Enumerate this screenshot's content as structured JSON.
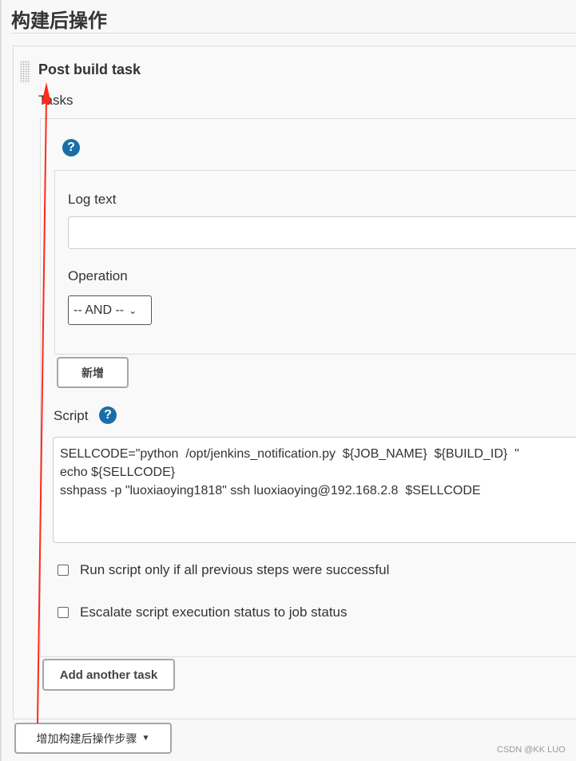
{
  "section_title": "构建后操作",
  "step": {
    "title": "Post build task",
    "tasks_label": "Tasks",
    "log_text_label": "Log text",
    "log_text_value": "",
    "operation_label": "Operation",
    "operation_value": "-- AND --",
    "add_button": "新增",
    "script_label": "Script",
    "script_lines": [
      "SELLCODE=\"python  /opt/jenkins_notification.py  ${JOB_NAME}  ${BUILD_ID}  \"",
      "echo ${SELLCODE}",
      "sshpass -p \"luoxiaoying1818\" ssh luoxiaoying@192.168.2.8  $SELLCODE"
    ],
    "checkbox_run_only": {
      "label": "Run script only if all previous steps were successful",
      "checked": false
    },
    "checkbox_escalate": {
      "label": "Escalate script execution status to job status",
      "checked": false
    },
    "add_another_task": "Add another task"
  },
  "add_post_build_step": "增加构建后操作步骤",
  "watermark": "CSDN @KK LUO",
  "colors": {
    "help_icon": "#1a6ea8",
    "annotation_arrow": "#ff2a1a"
  }
}
